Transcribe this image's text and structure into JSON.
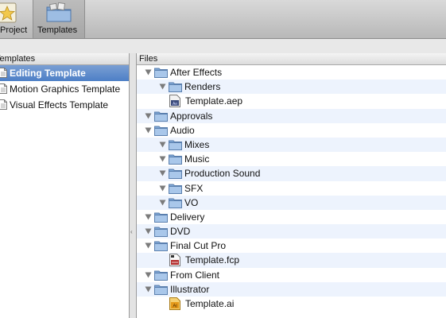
{
  "toolbar": {
    "project_label": "Project",
    "templates_label": "Templates"
  },
  "templates_panel": {
    "header": "Templates",
    "items": [
      {
        "label": "Editing Template",
        "selected": true
      },
      {
        "label": "Motion Graphics Template",
        "selected": false
      },
      {
        "label": "Visual Effects Template",
        "selected": false
      }
    ]
  },
  "files_panel": {
    "header": "Files",
    "rows": [
      {
        "name": "After Effects",
        "depth": 0,
        "kind": "folder",
        "expanded": true
      },
      {
        "name": "Renders",
        "depth": 1,
        "kind": "folder",
        "expanded": true
      },
      {
        "name": "Template.aep",
        "depth": 1,
        "kind": "aep-file"
      },
      {
        "name": "Approvals",
        "depth": 0,
        "kind": "folder",
        "expanded": true
      },
      {
        "name": "Audio",
        "depth": 0,
        "kind": "folder",
        "expanded": true
      },
      {
        "name": "Mixes",
        "depth": 1,
        "kind": "folder",
        "expanded": true
      },
      {
        "name": "Music",
        "depth": 1,
        "kind": "folder",
        "expanded": true
      },
      {
        "name": "Production Sound",
        "depth": 1,
        "kind": "folder",
        "expanded": true
      },
      {
        "name": "SFX",
        "depth": 1,
        "kind": "folder",
        "expanded": true
      },
      {
        "name": "VO",
        "depth": 1,
        "kind": "folder",
        "expanded": true
      },
      {
        "name": "Delivery",
        "depth": 0,
        "kind": "folder",
        "expanded": true
      },
      {
        "name": "DVD",
        "depth": 0,
        "kind": "folder",
        "expanded": true
      },
      {
        "name": "Final Cut Pro",
        "depth": 0,
        "kind": "folder",
        "expanded": true
      },
      {
        "name": "Template.fcp",
        "depth": 1,
        "kind": "fcp-file"
      },
      {
        "name": "From Client",
        "depth": 0,
        "kind": "folder",
        "expanded": true
      },
      {
        "name": "Illustrator",
        "depth": 0,
        "kind": "folder",
        "expanded": true
      },
      {
        "name": "Template.ai",
        "depth": 1,
        "kind": "ai-file"
      }
    ]
  },
  "colors": {
    "selection": "#4d7fc6",
    "alt_row": "#edf3fd",
    "folder": "#8fb4dc"
  }
}
